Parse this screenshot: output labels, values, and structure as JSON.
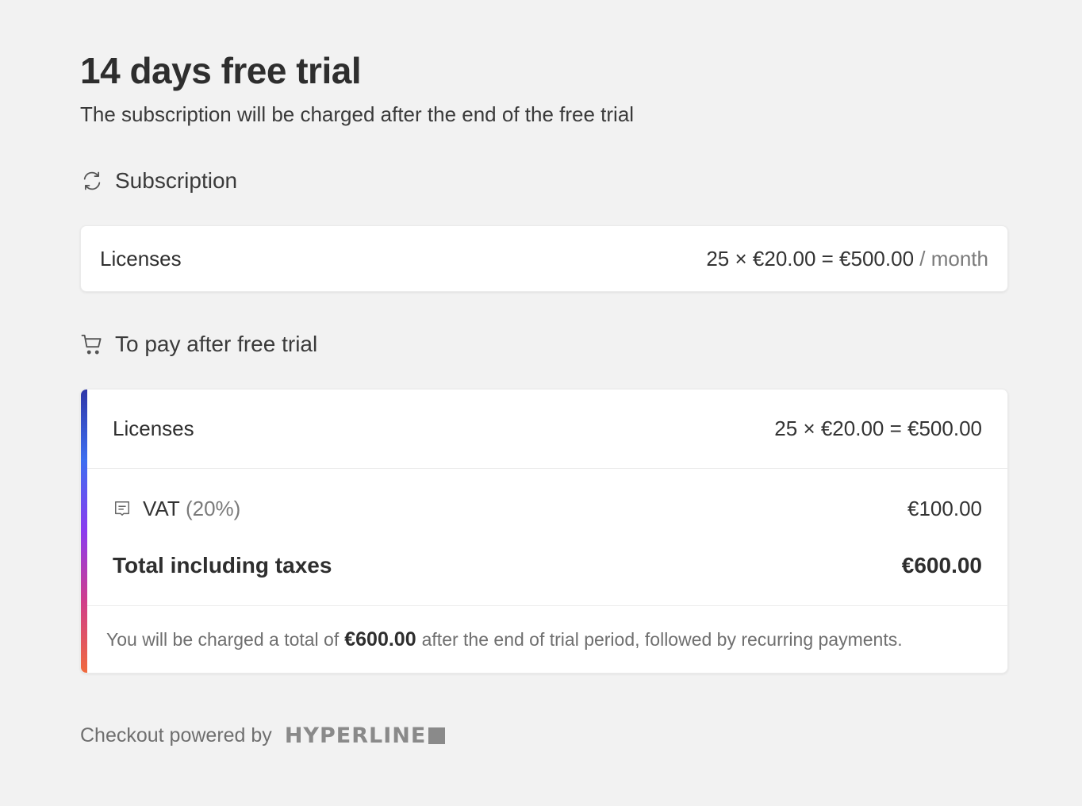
{
  "header": {
    "title": "14 days free trial",
    "subtitle": "The subscription will be charged after the end of the free trial"
  },
  "subscription": {
    "heading": "Subscription",
    "icon": "refresh-icon",
    "item_label": "Licenses",
    "item_price": "25 × €20.00 = €500.00",
    "item_period": "/ month"
  },
  "to_pay": {
    "heading": "To pay after free trial",
    "icon": "cart-icon",
    "licenses_label": "Licenses",
    "licenses_price": "25 × €20.00 = €500.00",
    "vat_label": "VAT",
    "vat_rate": "(20%)",
    "vat_icon": "receipt-icon",
    "vat_amount": "€100.00",
    "total_label": "Total including taxes",
    "total_amount": "€600.00",
    "note_prefix": "You will be charged a total of",
    "note_amount": "€600.00",
    "note_suffix": "after the end of trial period, followed by recurring payments.",
    "accent_gradient": [
      "#2f37a8",
      "#3d6ef0",
      "#8b3bef",
      "#d03e8a",
      "#f06a3d"
    ]
  },
  "footer": {
    "powered_by": "Checkout powered by",
    "brand": "HYPERLINE"
  }
}
